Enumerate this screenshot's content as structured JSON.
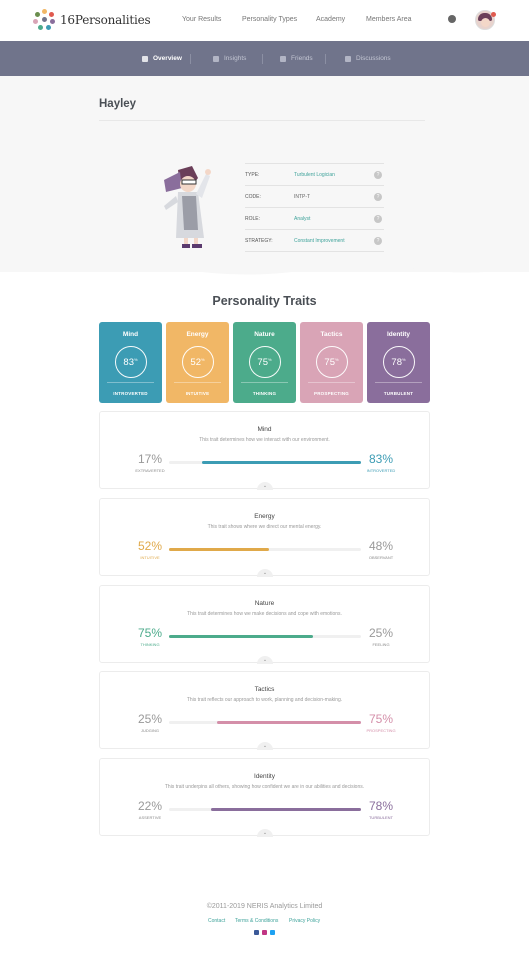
{
  "brand": {
    "name": "16Personalities"
  },
  "nav": {
    "items": [
      "Your Results",
      "Personality Types",
      "Academy",
      "Members Area"
    ]
  },
  "subnav": {
    "tabs": [
      "Overview",
      "Insights",
      "Friends",
      "Discussions"
    ]
  },
  "profile": {
    "name": "Hayley",
    "rows": [
      {
        "key": "TYPE:",
        "value": "Turbulent Logician"
      },
      {
        "key": "CODE:",
        "value": "INTP-T"
      },
      {
        "key": "ROLE:",
        "value": "Analyst"
      },
      {
        "key": "STRATEGY:",
        "value": "Constant Improvement"
      }
    ],
    "help": "?"
  },
  "traits_title": "Personality Traits",
  "cards": [
    {
      "title": "Mind",
      "pct": "83",
      "label": "INTROVERTED",
      "color": "#3c9cb4"
    },
    {
      "title": "Energy",
      "pct": "52",
      "label": "INTUITIVE",
      "color": "#f1b766"
    },
    {
      "title": "Nature",
      "pct": "75",
      "label": "THINKING",
      "color": "#4cab8b"
    },
    {
      "title": "Tactics",
      "pct": "75",
      "label": "PROSPECTING",
      "color": "#d9a4b6"
    },
    {
      "title": "Identity",
      "pct": "78",
      "label": "TURBULENT",
      "color": "#8a6e9c"
    }
  ],
  "percent_sign": "%",
  "boxes": [
    {
      "title": "Mind",
      "desc": "This trait determines how we interact with our environment.",
      "left_pct": "17%",
      "left_label": "EXTRAVERTED",
      "right_pct": "83%",
      "right_label": "INTROVERTED",
      "dominant": "right",
      "value": 83,
      "color": "#3c9cb4"
    },
    {
      "title": "Energy",
      "desc": "This trait shows where we direct our mental energy.",
      "left_pct": "52%",
      "left_label": "INTUITIVE",
      "right_pct": "48%",
      "right_label": "OBSERVANT",
      "dominant": "left",
      "value": 52,
      "color": "#e0a94a"
    },
    {
      "title": "Nature",
      "desc": "This trait determines how we make decisions and cope with emotions.",
      "left_pct": "75%",
      "left_label": "THINKING",
      "right_pct": "25%",
      "right_label": "FEELING",
      "dominant": "left",
      "value": 75,
      "color": "#4cab8b"
    },
    {
      "title": "Tactics",
      "desc": "This trait reflects our approach to work, planning and decision-making.",
      "left_pct": "25%",
      "left_label": "JUDGING",
      "right_pct": "75%",
      "right_label": "PROSPECTING",
      "dominant": "right",
      "value": 75,
      "color": "#d48fa9"
    },
    {
      "title": "Identity",
      "desc": "This trait underpins all others, showing how confident we are in our abilities and decisions.",
      "left_pct": "22%",
      "left_label": "ASSERTIVE",
      "right_pct": "78%",
      "right_label": "TURBULENT",
      "dominant": "right",
      "value": 78,
      "color": "#8a6e9c"
    }
  ],
  "footer": {
    "copyright": "©2011-2019 NERIS Analytics Limited",
    "links": [
      "Contact",
      "Terms & Conditions",
      "Privacy Policy"
    ],
    "social": [
      {
        "icon": "facebook-icon",
        "color": "#3b5998"
      },
      {
        "icon": "instagram-icon",
        "color": "#c13584"
      },
      {
        "icon": "twitter-icon",
        "color": "#1da1f2"
      }
    ]
  }
}
